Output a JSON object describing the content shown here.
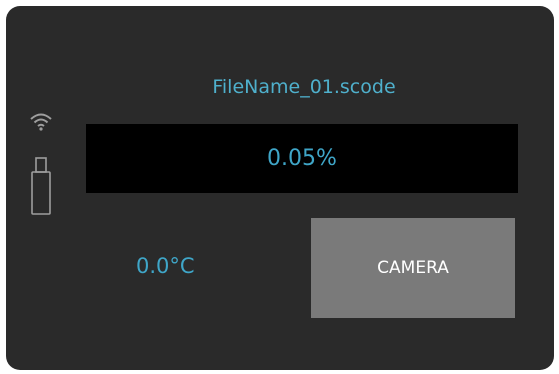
{
  "job": {
    "file_name": "FileName_01.scode",
    "progress_text": "0.05%",
    "progress": 0.0005
  },
  "status": {
    "temperature": "0.0°C",
    "wifi_icon": "wifi-icon",
    "usb_icon": "usb-drive-icon"
  },
  "actions": {
    "camera_label": "CAMERA"
  },
  "colors": {
    "device_background": "#2a2a2a",
    "accent_text": "#3fa6c8",
    "progress_box": "#000000",
    "button_background": "#7a7a7a",
    "icon": "#9e9e9e"
  }
}
